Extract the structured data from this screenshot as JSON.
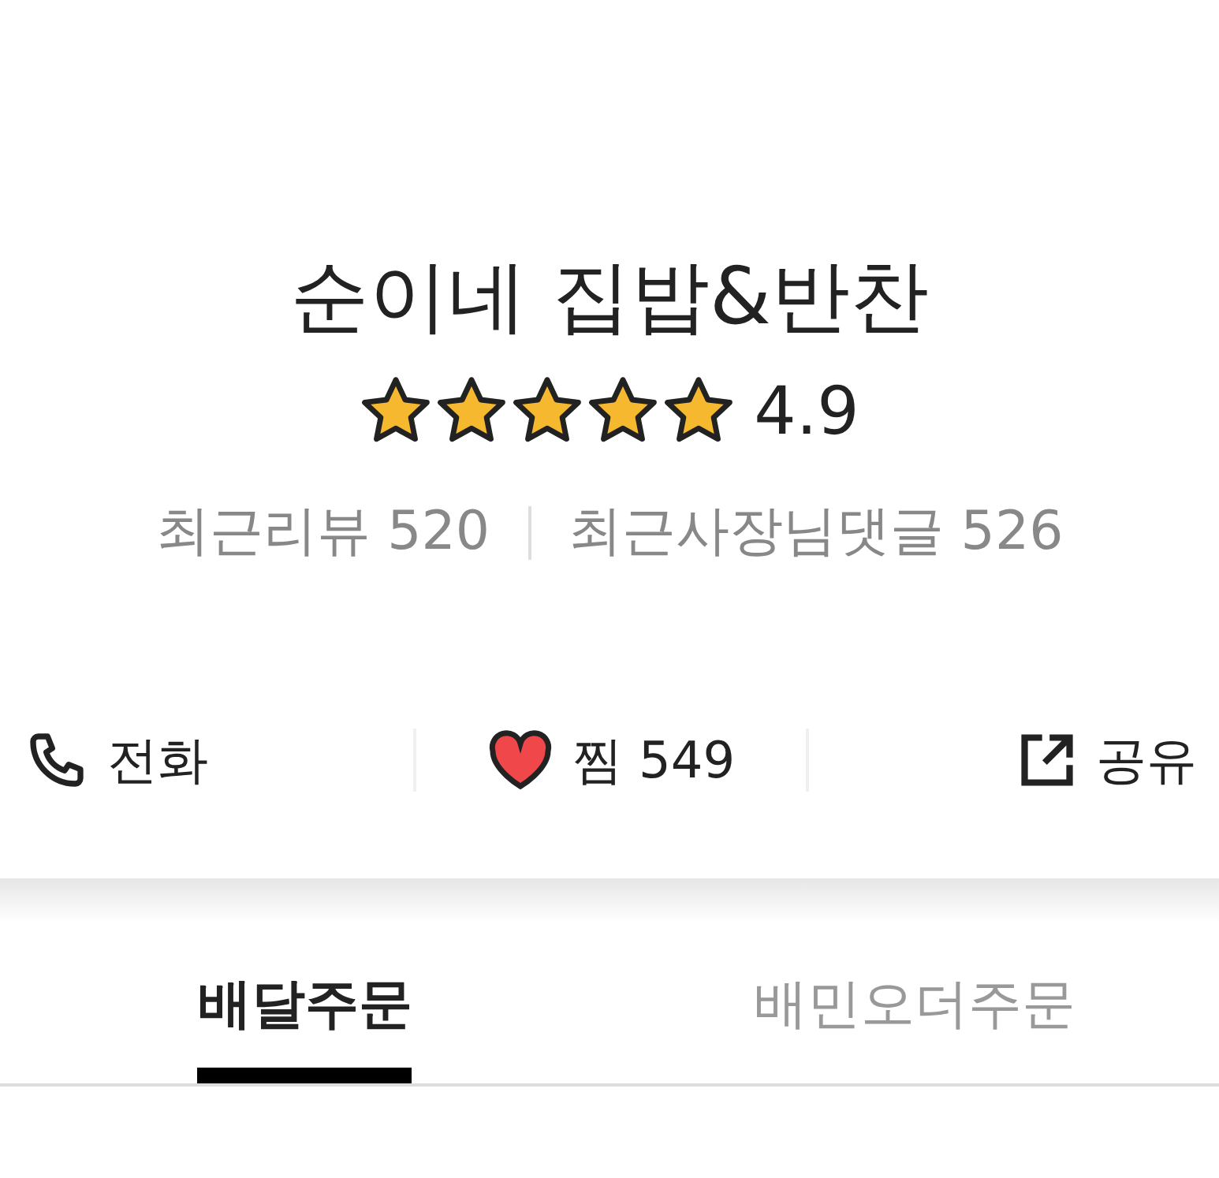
{
  "store": {
    "name": "순이네 집밥&반찬",
    "stars": 5,
    "rating": "4.9"
  },
  "review_counts": [
    {
      "label": "최근리뷰 520"
    },
    {
      "label": "최근사장님댓글 526"
    }
  ],
  "actions": [
    {
      "kind": "call",
      "label": "전화"
    },
    {
      "kind": "favorite",
      "label": "찜",
      "count": "549",
      "favorited": true
    },
    {
      "kind": "share",
      "label": "공유"
    }
  ],
  "tabs": [
    {
      "label": "배달주문",
      "selected": true
    },
    {
      "label": "배민오더주문",
      "selected": false
    }
  ]
}
